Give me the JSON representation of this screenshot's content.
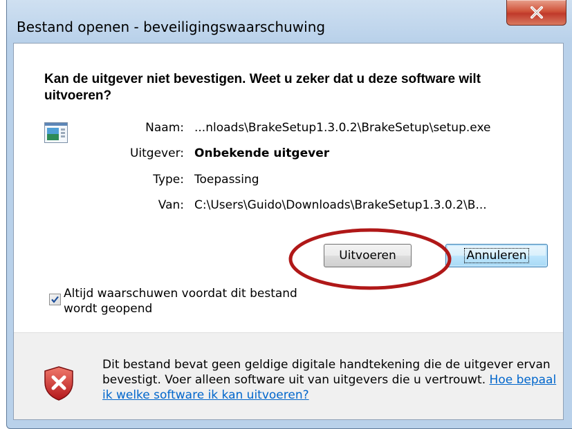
{
  "window": {
    "title": "Bestand openen - beveiligingswaarschuwing",
    "close_glyph": "X"
  },
  "main": {
    "headline": "Kan de uitgever niet bevestigen. Weet u zeker dat u deze software wilt uitvoeren?",
    "fields": [
      {
        "label": "Naam:",
        "value": "...nloads\\BrakeSetup1.3.0.2\\BrakeSetup\\setup.exe"
      },
      {
        "label": "Uitgever:",
        "value": "Onbekende uitgever"
      },
      {
        "label": "Type:",
        "value": "Toepassing"
      },
      {
        "label": "Van:",
        "value": "C:\\Users\\Guido\\Downloads\\BrakeSetup1.3.0.2\\B..."
      }
    ],
    "run_button": "Uitvoeren",
    "cancel_button": "Annuleren",
    "checkbox_label": "Altijd waarschuwen voordat dit bestand wordt geopend",
    "checkbox_checked": true
  },
  "warning": {
    "text": "Dit bestand bevat geen geldige digitale handtekening die de uitgever ervan bevestigt. Voer alleen software uit van uitgevers die u vertrouwt.",
    "link": "Hoe bepaal ik welke software ik kan uitvoeren?"
  },
  "colors": {
    "highlight_ellipse": "#b01818",
    "link": "#0066cc"
  },
  "icons": {
    "app": "application-icon",
    "shield": "shield-error-icon",
    "close": "close-icon"
  }
}
